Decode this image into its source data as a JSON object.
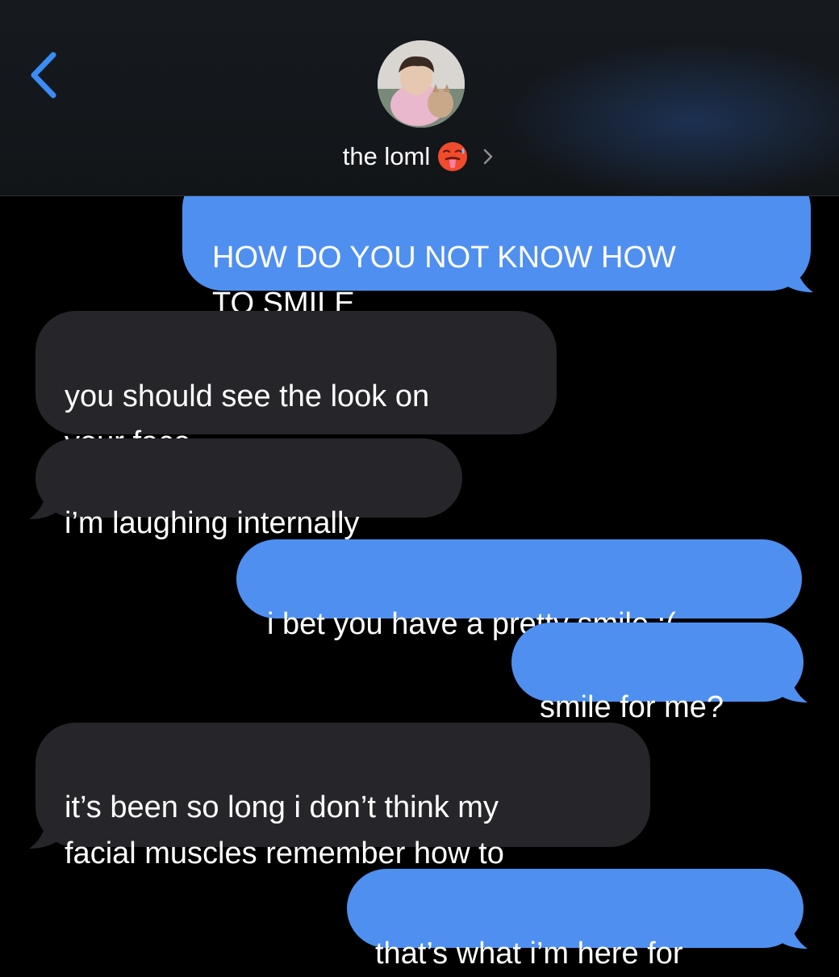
{
  "header": {
    "back_icon": "chevron-left-icon",
    "contact_name": "the loml",
    "contact_emoji": "hot-face-emoji",
    "disclosure_icon": "chevron-right-icon",
    "accent_color": "#3b8cf5"
  },
  "colors": {
    "outgoing_bubble": "#4f8ff0",
    "incoming_bubble": "#26262a",
    "background": "#000000"
  },
  "messages": [
    {
      "direction": "outgoing",
      "text": "HOW DO YOU NOT KNOW HOW\nTO SMILE"
    },
    {
      "direction": "incoming",
      "text": "you should see the look on\nyour face"
    },
    {
      "direction": "incoming",
      "text": "i’m laughing internally"
    },
    {
      "direction": "outgoing",
      "text": "i bet you have a pretty smile :("
    },
    {
      "direction": "outgoing",
      "text": "smile for me?"
    },
    {
      "direction": "incoming",
      "text": "it’s been so long i don’t think my\nfacial muscles remember how to"
    },
    {
      "direction": "outgoing",
      "text": "that’s what i’m here for"
    }
  ]
}
